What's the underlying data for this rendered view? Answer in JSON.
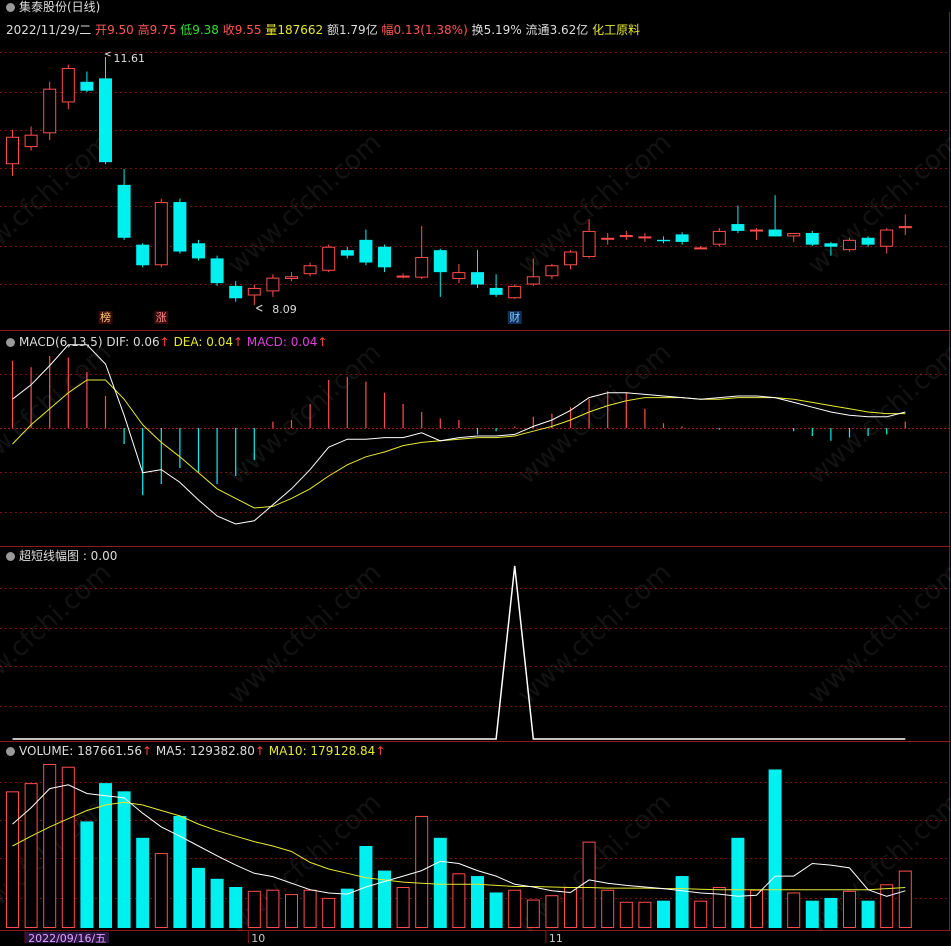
{
  "topbar": {
    "title": "集泰股份(日线)",
    "date": "2022/11/29/二",
    "open_label": "开",
    "open": "9.50",
    "high_label": "高",
    "high": "9.75",
    "low_label": "低",
    "low": "9.38",
    "close_label": "收",
    "close": "9.55",
    "vol_label": "量",
    "vol": "187662",
    "amt_label": "额",
    "amt": "1.79亿",
    "chg_label": "幅",
    "chg": "0.13(1.38%)",
    "turn_label": "换",
    "turn": "5.19%",
    "float_label": "流通",
    "float": "3.62亿",
    "sector": "化工原料"
  },
  "price_panel": {
    "max_label": "11.61",
    "min_label": "8.09",
    "marks": [
      {
        "text": "榜",
        "idx": 5
      },
      {
        "text": "涨",
        "idx": 8
      },
      {
        "text": "财",
        "idx": 27
      }
    ]
  },
  "macd_panel": {
    "title": "MACD(6,13,5)",
    "dif": "DIF: 0.06",
    "dea": "DEA: 0.04",
    "macd": "MACD: 0.04"
  },
  "ultra_panel": {
    "title": "超短线幅图 : 0.00"
  },
  "vol_panel": {
    "title": "VOLUME: 187661.56",
    "ma5": "MA5: 129382.80",
    "ma10": "MA10: 179128.84"
  },
  "xaxis": {
    "labels": [
      {
        "text": "2022/09/16/五",
        "idx": 1
      },
      {
        "text": "10",
        "idx": 13
      },
      {
        "text": "11",
        "idx": 29
      }
    ]
  },
  "watermark": "www.cfchi.com",
  "colors": {
    "up": "#ff4d4d",
    "down": "#00f0f0",
    "dif": "#ffffff",
    "dea": "#e8e830",
    "grid": "#7a1010"
  },
  "chart_data": {
    "type": "candlestick",
    "candles": [
      {
        "o": 10.05,
        "h": 10.55,
        "l": 9.88,
        "c": 10.45
      },
      {
        "o": 10.3,
        "h": 10.6,
        "l": 10.25,
        "c": 10.48
      },
      {
        "o": 10.5,
        "h": 11.25,
        "l": 10.4,
        "c": 11.15
      },
      {
        "o": 10.95,
        "h": 11.5,
        "l": 10.85,
        "c": 11.45
      },
      {
        "o": 11.25,
        "h": 11.4,
        "l": 11.1,
        "c": 11.12
      },
      {
        "o": 11.3,
        "h": 11.61,
        "l": 10.05,
        "c": 10.08
      },
      {
        "o": 9.75,
        "h": 9.98,
        "l": 8.95,
        "c": 8.98
      },
      {
        "o": 8.88,
        "h": 8.9,
        "l": 8.55,
        "c": 8.58
      },
      {
        "o": 8.58,
        "h": 9.55,
        "l": 8.55,
        "c": 9.5
      },
      {
        "o": 9.5,
        "h": 9.55,
        "l": 8.75,
        "c": 8.78
      },
      {
        "o": 8.9,
        "h": 8.95,
        "l": 8.65,
        "c": 8.68
      },
      {
        "o": 8.68,
        "h": 8.72,
        "l": 8.28,
        "c": 8.32
      },
      {
        "o": 8.28,
        "h": 8.35,
        "l": 8.05,
        "c": 8.1
      },
      {
        "o": 8.14,
        "h": 8.3,
        "l": 8.0,
        "c": 8.25
      },
      {
        "o": 8.2,
        "h": 8.45,
        "l": 8.12,
        "c": 8.4
      },
      {
        "o": 8.38,
        "h": 8.48,
        "l": 8.35,
        "c": 8.42
      },
      {
        "o": 8.45,
        "h": 8.62,
        "l": 8.42,
        "c": 8.58
      },
      {
        "o": 8.5,
        "h": 8.88,
        "l": 8.48,
        "c": 8.85
      },
      {
        "o": 8.8,
        "h": 8.85,
        "l": 8.68,
        "c": 8.72
      },
      {
        "o": 8.95,
        "h": 9.1,
        "l": 8.58,
        "c": 8.62
      },
      {
        "o": 8.85,
        "h": 8.88,
        "l": 8.48,
        "c": 8.55
      },
      {
        "o": 8.42,
        "h": 8.46,
        "l": 8.39,
        "c": 8.43
      },
      {
        "o": 8.4,
        "h": 9.15,
        "l": 8.38,
        "c": 8.7
      },
      {
        "o": 8.8,
        "h": 8.82,
        "l": 8.12,
        "c": 8.48
      },
      {
        "o": 8.38,
        "h": 8.6,
        "l": 8.32,
        "c": 8.48
      },
      {
        "o": 8.48,
        "h": 8.8,
        "l": 8.25,
        "c": 8.3
      },
      {
        "o": 8.25,
        "h": 8.45,
        "l": 8.12,
        "c": 8.15
      },
      {
        "o": 8.1,
        "h": 8.3,
        "l": 8.09,
        "c": 8.28
      },
      {
        "o": 8.3,
        "h": 8.68,
        "l": 8.28,
        "c": 8.42
      },
      {
        "o": 8.42,
        "h": 8.6,
        "l": 8.38,
        "c": 8.58
      },
      {
        "o": 8.58,
        "h": 8.8,
        "l": 8.52,
        "c": 8.78
      },
      {
        "o": 8.7,
        "h": 9.25,
        "l": 8.68,
        "c": 9.08
      },
      {
        "o": 8.98,
        "h": 9.05,
        "l": 8.88,
        "c": 8.98
      },
      {
        "o": 8.99,
        "h": 9.08,
        "l": 8.95,
        "c": 9.02
      },
      {
        "o": 9.0,
        "h": 9.05,
        "l": 8.92,
        "c": 9.0
      },
      {
        "o": 8.95,
        "h": 9.0,
        "l": 8.9,
        "c": 8.93
      },
      {
        "o": 9.03,
        "h": 9.06,
        "l": 8.88,
        "c": 8.92
      },
      {
        "o": 8.83,
        "h": 8.86,
        "l": 8.82,
        "c": 8.84
      },
      {
        "o": 8.88,
        "h": 9.12,
        "l": 8.85,
        "c": 9.08
      },
      {
        "o": 9.18,
        "h": 9.45,
        "l": 9.05,
        "c": 9.08
      },
      {
        "o": 9.1,
        "h": 9.12,
        "l": 8.95,
        "c": 9.1
      },
      {
        "o": 9.1,
        "h": 9.6,
        "l": 9.0,
        "c": 9.0
      },
      {
        "o": 9.0,
        "h": 9.05,
        "l": 8.92,
        "c": 9.05
      },
      {
        "o": 9.05,
        "h": 9.08,
        "l": 8.86,
        "c": 8.88
      },
      {
        "o": 8.9,
        "h": 8.92,
        "l": 8.72,
        "c": 8.85
      },
      {
        "o": 8.8,
        "h": 8.98,
        "l": 8.78,
        "c": 8.95
      },
      {
        "o": 8.98,
        "h": 9.0,
        "l": 8.85,
        "c": 8.88
      },
      {
        "o": 8.85,
        "h": 9.12,
        "l": 8.75,
        "c": 9.1
      },
      {
        "o": 9.12,
        "h": 9.32,
        "l": 9.02,
        "c": 9.15
      }
    ],
    "macd": {
      "dif": [
        0.18,
        0.27,
        0.39,
        0.52,
        0.52,
        0.4,
        0.08,
        -0.28,
        -0.26,
        -0.34,
        -0.45,
        -0.55,
        -0.6,
        -0.58,
        -0.48,
        -0.38,
        -0.26,
        -0.12,
        -0.07,
        -0.07,
        -0.06,
        -0.06,
        -0.03,
        -0.08,
        -0.06,
        -0.05,
        -0.05,
        -0.04,
        0.01,
        0.05,
        0.11,
        0.19,
        0.22,
        0.22,
        0.21,
        0.2,
        0.19,
        0.18,
        0.19,
        0.2,
        0.2,
        0.19,
        0.16,
        0.13,
        0.1,
        0.08,
        0.07,
        0.07,
        0.1
      ],
      "dea": [
        -0.1,
        0.02,
        0.12,
        0.22,
        0.3,
        0.3,
        0.18,
        0.02,
        -0.09,
        -0.18,
        -0.28,
        -0.38,
        -0.44,
        -0.5,
        -0.49,
        -0.44,
        -0.38,
        -0.3,
        -0.23,
        -0.18,
        -0.15,
        -0.11,
        -0.09,
        -0.08,
        -0.07,
        -0.06,
        -0.06,
        -0.05,
        -0.02,
        0.01,
        0.05,
        0.1,
        0.14,
        0.17,
        0.19,
        0.19,
        0.19,
        0.18,
        0.18,
        0.19,
        0.19,
        0.19,
        0.18,
        0.16,
        0.14,
        0.12,
        0.1,
        0.09,
        0.09
      ],
      "hist": [
        0.42,
        0.38,
        0.45,
        0.44,
        0.35,
        0.2,
        -0.1,
        -0.42,
        -0.35,
        -0.25,
        -0.28,
        -0.35,
        -0.3,
        -0.2,
        0.04,
        0.05,
        0.15,
        0.3,
        0.32,
        0.29,
        0.22,
        0.15,
        0.1,
        0.06,
        0.05,
        -0.04,
        -0.02,
        0.01,
        0.07,
        0.09,
        0.13,
        0.18,
        0.23,
        0.22,
        0.12,
        0.03,
        0.01,
        0.0,
        -0.01,
        0.0,
        0.0,
        0.0,
        -0.02,
        -0.05,
        -0.08,
        -0.06,
        -0.05,
        -0.04,
        0.04
      ]
    },
    "ultra": {
      "values": [
        0,
        0,
        0,
        0,
        0,
        0,
        0,
        0,
        0,
        0,
        0,
        0,
        0,
        0,
        0,
        0,
        0,
        0,
        0,
        0,
        0,
        0,
        0,
        0,
        0,
        0,
        0,
        1,
        0,
        0,
        0,
        0,
        0,
        0,
        0,
        0,
        0,
        0,
        0,
        0,
        0,
        0,
        0,
        0,
        0,
        0,
        0,
        0,
        0
      ]
    },
    "volume": {
      "values": [
        250000,
        265000,
        300000,
        295000,
        195000,
        265000,
        250000,
        165000,
        137000,
        205000,
        110000,
        90000,
        75000,
        68000,
        70000,
        62000,
        70000,
        55000,
        72000,
        150000,
        105000,
        75000,
        205000,
        165000,
        100000,
        95000,
        65000,
        70000,
        52000,
        60000,
        75000,
        158000,
        70000,
        48000,
        48000,
        50000,
        95000,
        50000,
        75000,
        165000,
        70000,
        290000,
        65000,
        50000,
        55000,
        68000,
        50000,
        80000,
        105000
      ],
      "ma5": [
        190000,
        220000,
        255000,
        262000,
        246000,
        242000,
        238000,
        210000,
        185000,
        168000,
        150000,
        132000,
        115000,
        100000,
        94000,
        82000,
        70000,
        64000,
        62000,
        75000,
        85000,
        95000,
        105000,
        122000,
        118000,
        105000,
        95000,
        80000,
        75000,
        68000,
        65000,
        88000,
        82000,
        78000,
        75000,
        72000,
        68000,
        64000,
        62000,
        58000,
        60000,
        95000,
        95000,
        118000,
        115000,
        110000,
        70000,
        58000,
        68000
      ],
      "ma10": [
        150000,
        168000,
        185000,
        200000,
        215000,
        225000,
        230000,
        225000,
        215000,
        205000,
        190000,
        178000,
        168000,
        158000,
        150000,
        140000,
        120000,
        108000,
        100000,
        92000,
        88000,
        84000,
        82000,
        80000,
        80000,
        80000,
        78000,
        76000,
        76000,
        75000,
        74000,
        74000,
        73000,
        73000,
        73000,
        72000,
        72000,
        71000,
        70000,
        70000,
        70000,
        70000,
        70000,
        70000,
        70000,
        70000,
        70000,
        72000,
        74000
      ]
    }
  }
}
